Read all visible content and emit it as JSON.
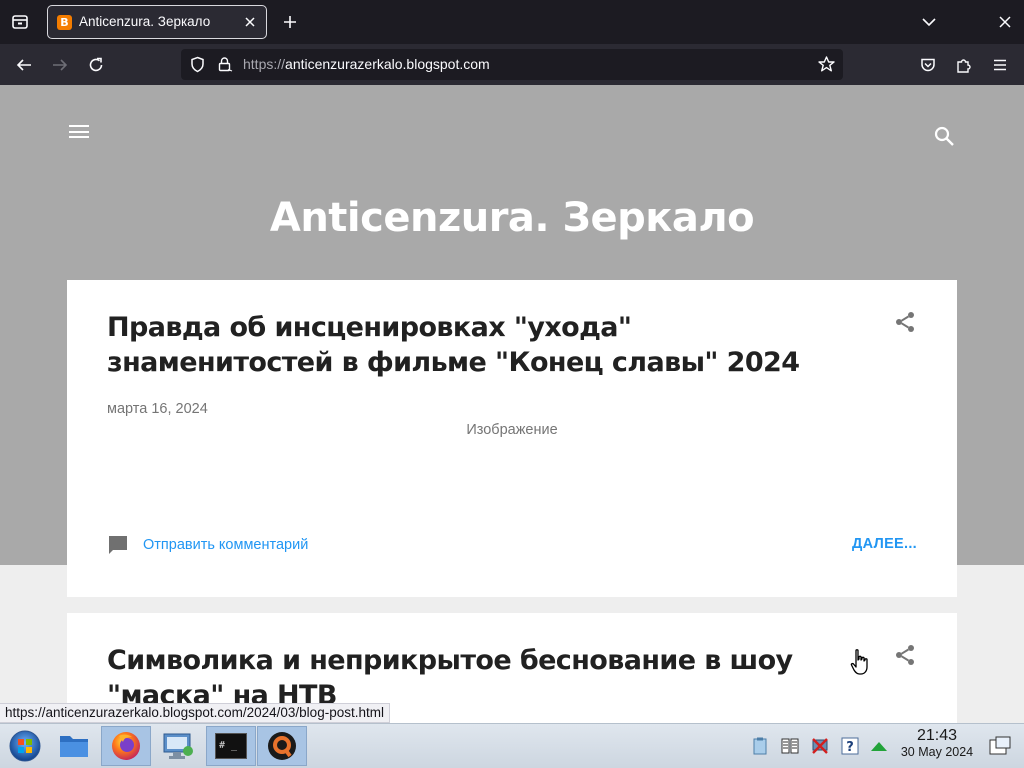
{
  "browser": {
    "tab_title": "Anticenzura. Зеркало",
    "tab_favicon_letter": "B",
    "url_scheme": "https://",
    "url_host": "anticenzurazerkalo.blogspot.com",
    "status_url": "https://anticenzurazerkalo.blogspot.com/2024/03/blog-post.html"
  },
  "blog": {
    "title": "Anticenzura. Зеркало"
  },
  "posts": [
    {
      "title": "Правда об инсценировках \"ухода\" знаменитостей в фильме \"Конец славы\" 2024",
      "date": "марта 16, 2024",
      "image_alt": "Изображение",
      "comment_label": "Отправить комментарий",
      "more_label": "ДАЛЕЕ..."
    },
    {
      "title": "Символика и неприкрытое беснование в шоу \"маска\" на НТВ"
    }
  ],
  "taskbar": {
    "time": "21:43",
    "date": "30 May 2024",
    "terminal_label": "# _"
  },
  "colors": {
    "hero_bg": "#a9a9a9",
    "link": "#2196f3",
    "favicon": "#f57d00"
  }
}
